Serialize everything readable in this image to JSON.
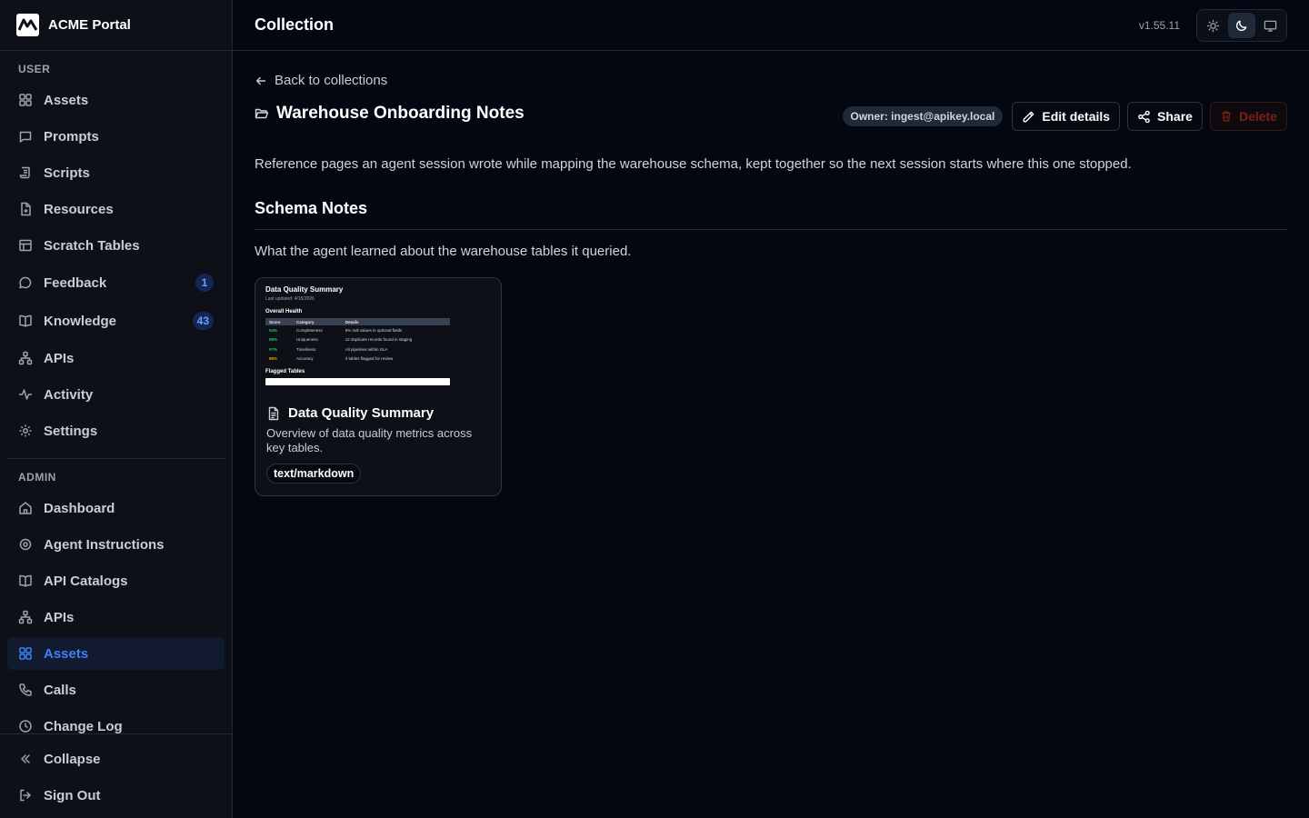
{
  "app": {
    "brand_name": "ACME Portal",
    "version": "v1.55.11"
  },
  "sidebar": {
    "user_section_label": "USER",
    "admin_section_label": "ADMIN",
    "user_items": [
      {
        "label": "Assets",
        "icon": "grid-icon"
      },
      {
        "label": "Prompts",
        "icon": "chat-icon"
      },
      {
        "label": "Scripts",
        "icon": "script-icon"
      },
      {
        "label": "Resources",
        "icon": "file-icon"
      },
      {
        "label": "Scratch Tables",
        "icon": "table-icon"
      },
      {
        "label": "Feedback",
        "icon": "message-icon",
        "badge": "1"
      },
      {
        "label": "Knowledge",
        "icon": "book-icon",
        "badge": "43"
      },
      {
        "label": "APIs",
        "icon": "network-icon"
      },
      {
        "label": "Activity",
        "icon": "activity-icon"
      },
      {
        "label": "Settings",
        "icon": "gear-icon"
      }
    ],
    "admin_items": [
      {
        "label": "Dashboard",
        "icon": "home-icon"
      },
      {
        "label": "Agent Instructions",
        "icon": "wand-icon"
      },
      {
        "label": "API Catalogs",
        "icon": "book-icon"
      },
      {
        "label": "APIs",
        "icon": "network-icon"
      },
      {
        "label": "Assets",
        "icon": "grid-icon",
        "active": true
      },
      {
        "label": "Calls",
        "icon": "phone-icon"
      },
      {
        "label": "Change Log",
        "icon": "clock-icon"
      }
    ],
    "collapse_label": "Collapse",
    "signout_label": "Sign Out"
  },
  "header": {
    "title": "Collection",
    "theme_options": [
      "light",
      "dark",
      "system"
    ],
    "active_theme": "dark"
  },
  "collection": {
    "back_label": "Back to collections",
    "title": "Warehouse Onboarding Notes",
    "owner_label": "Owner: ingest@apikey.local",
    "edit_label": "Edit details",
    "share_label": "Share",
    "delete_label": "Delete",
    "description": "Reference pages an agent session wrote while mapping the warehouse schema, kept together so the next session starts where this one stopped.",
    "section_title": "Schema Notes",
    "section_description": "What the agent learned about the warehouse tables it queried."
  },
  "card": {
    "title": "Data Quality Summary",
    "description": "Overview of data quality metrics across key tables.",
    "mime": "text/markdown",
    "preview": {
      "title": "Data Quality Summary",
      "meta": "Last updated: 4/15/2026",
      "heading": "Overall Health",
      "columns": [
        "Score",
        "Category",
        "Details"
      ],
      "rows": [
        {
          "score": "94%",
          "category": "Completeness",
          "details": "6% null values in optional fields",
          "tone": "green"
        },
        {
          "score": "89%",
          "category": "Uniqueness",
          "details": "12 duplicate records found in staging",
          "tone": "green"
        },
        {
          "score": "97%",
          "category": "Timeliness",
          "details": "All pipelines within SLA",
          "tone": "green"
        },
        {
          "score": "88%",
          "category": "Accuracy",
          "details": "3 tables flagged for review",
          "tone": "orange"
        }
      ],
      "heading2": "Flagged Tables"
    }
  },
  "colors": {
    "accent": "#3b82f6",
    "background": "#030712",
    "sidebar": "#0d1117",
    "danger": "#7f1d1d"
  }
}
